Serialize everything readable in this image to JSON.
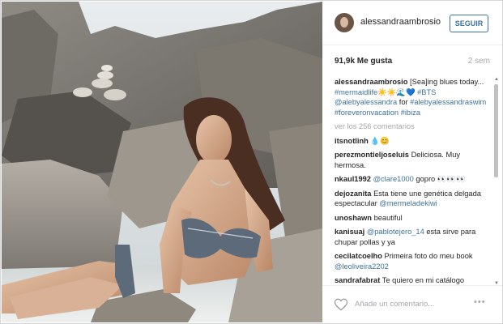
{
  "post": {
    "username": "alessandraambrosio",
    "follow_label": "SEGUIR",
    "likes": "91,9k Me gusta",
    "time_ago": "2 sem"
  },
  "caption": {
    "user": "alessandraambrosio",
    "text_1": "[Sea]ing blues today... ",
    "tag_1": "#mermaidlife",
    "emoji": "☀️☀️🌊💙",
    "tag_2": "#BTS",
    "mention_1": "@alebyalessandra",
    "text_2": " for ",
    "tag_3": "#alebyalessandraswim",
    "tag_4": "#foreveronvacation",
    "tag_5": "#ibiza"
  },
  "view_all": "ver los 256 comentarios",
  "comments": [
    {
      "user": "itsnotlinh",
      "text": "💧😊"
    },
    {
      "user": "perezmontieljoseluis",
      "text": "Deliciosa. Muy hermosa."
    },
    {
      "user": "nkaul1992",
      "mention": "@clare1000",
      "text": " gopro 👀👀👀"
    },
    {
      "user": "dejozanita",
      "text": "Esta tiene une genética delgada espectacular ",
      "mention": "@mermeladekiwi"
    },
    {
      "user": "unoshawn",
      "text": "beautiful"
    },
    {
      "user": "kanisuaj",
      "mention": "@pablotejero_14",
      "text": " esta sirve para chupar pollas y ya"
    },
    {
      "user": "cecilatcoelho",
      "text": "Primeira foto do meu book ",
      "mention": "@leoliveira2202"
    },
    {
      "user": "sandrafabrat",
      "text": "Te quiero en mi catálogo"
    }
  ],
  "footer": {
    "add_comment": "Añade un comentario...",
    "more": "•••"
  },
  "colors": {
    "link": "#3f729b",
    "muted": "#a5a7aa",
    "border": "#efefef"
  }
}
